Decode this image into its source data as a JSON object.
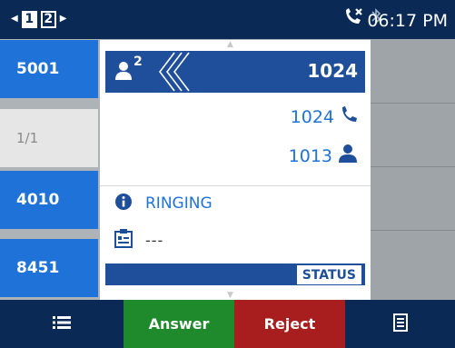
{
  "status_bar": {
    "pages": [
      "1",
      "2"
    ],
    "active_page": "1",
    "clock": "06:17 PM"
  },
  "lines": [
    {
      "label": "5001"
    },
    {
      "label": "1/1"
    },
    {
      "label": "4010"
    },
    {
      "label": "8451"
    }
  ],
  "call": {
    "conference_count": "2",
    "header_number": "1024",
    "members": [
      {
        "number": "1024",
        "icon": "phone-icon"
      },
      {
        "number": "1013",
        "icon": "person-icon"
      }
    ],
    "status": "RINGING",
    "info": "---",
    "status_button": "STATUS"
  },
  "softkeys": {
    "answer": "Answer",
    "reject": "Reject"
  },
  "colors": {
    "topbar": "#0a2a55",
    "line_blue": "#1f73d8",
    "header_blue": "#1f4f9a",
    "answer_green": "#1e8a2b",
    "reject_red": "#a81d1d"
  }
}
